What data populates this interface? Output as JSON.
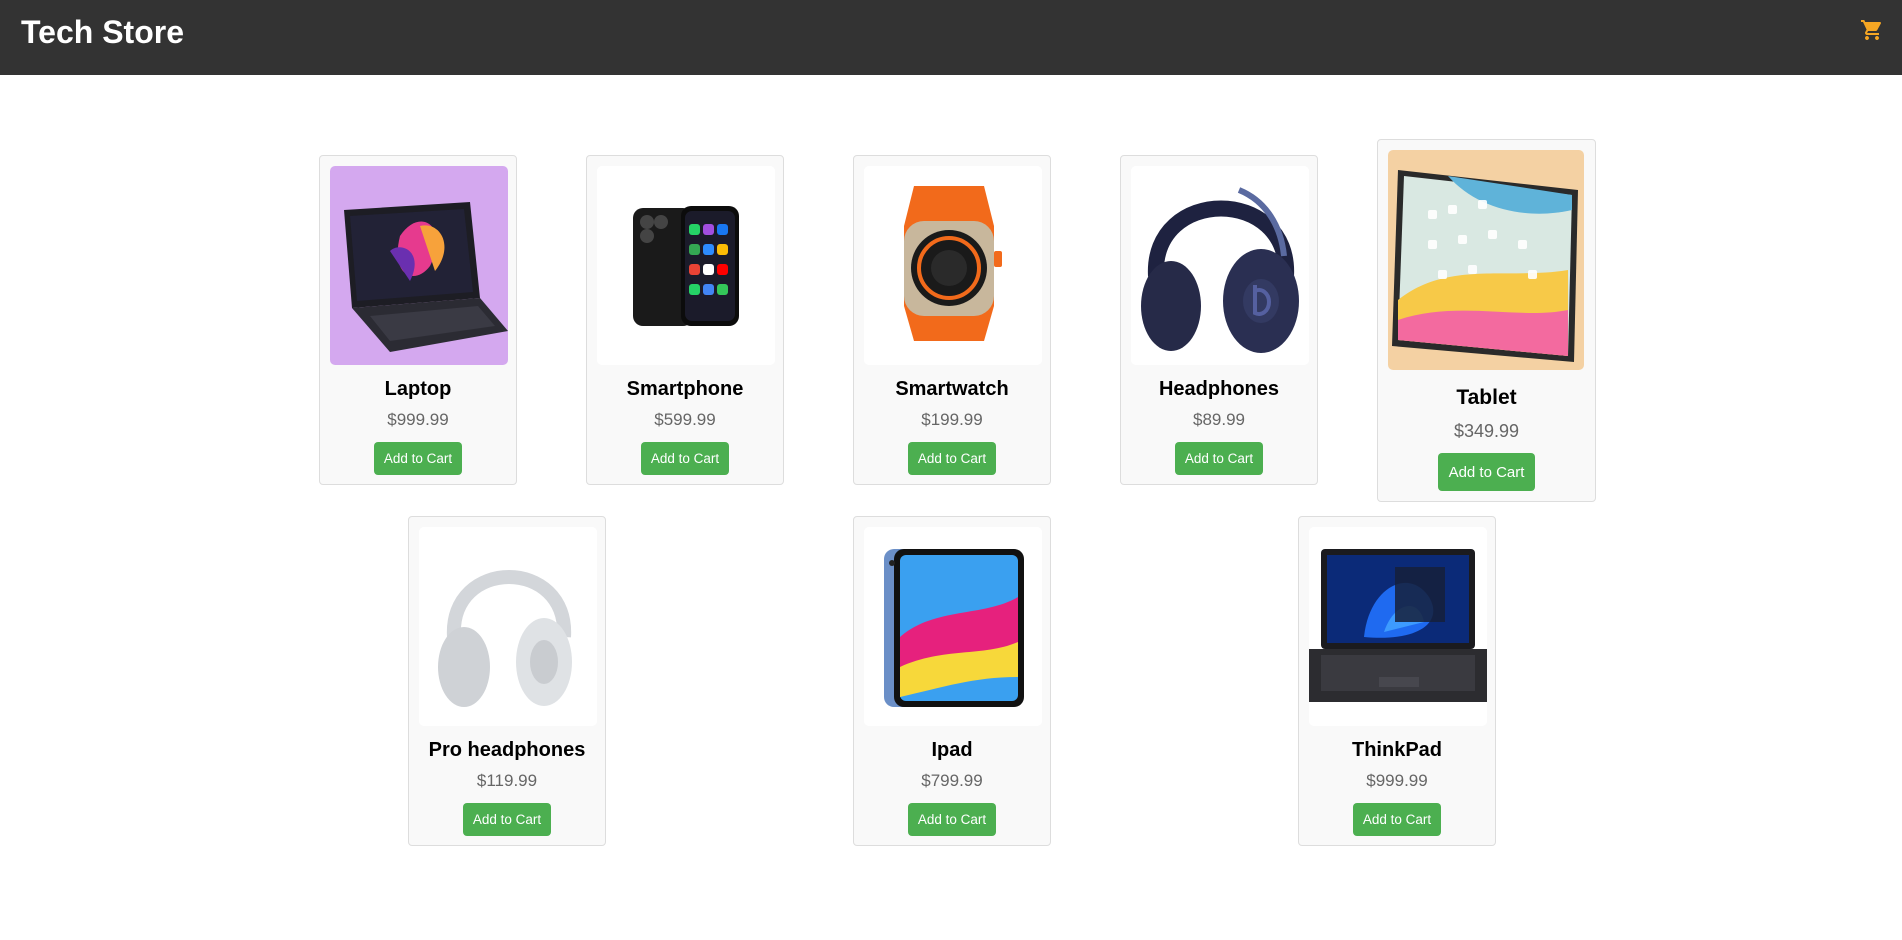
{
  "header": {
    "title": "Tech Store",
    "cart_icon": "shopping-cart-icon",
    "cart_color": "#f5a623",
    "background": "#333333"
  },
  "accent_color": "#4caf50",
  "products": [
    {
      "name": "Laptop",
      "price": "$999.99",
      "button": "Add to Cart",
      "image": "laptop-image"
    },
    {
      "name": "Smartphone",
      "price": "$599.99",
      "button": "Add to Cart",
      "image": "smartphone-image"
    },
    {
      "name": "Smartwatch",
      "price": "$199.99",
      "button": "Add to Cart",
      "image": "smartwatch-image"
    },
    {
      "name": "Headphones",
      "price": "$89.99",
      "button": "Add to Cart",
      "image": "headphones-image"
    },
    {
      "name": "Tablet",
      "price": "$349.99",
      "button": "Add to Cart",
      "image": "tablet-image"
    },
    {
      "name": "Pro headphones",
      "price": "$119.99",
      "button": "Add to Cart",
      "image": "pro-headphones-image"
    },
    {
      "name": "Ipad",
      "price": "$799.99",
      "button": "Add to Cart",
      "image": "ipad-image"
    },
    {
      "name": "ThinkPad",
      "price": "$999.99",
      "button": "Add to Cart",
      "image": "thinkpad-image"
    }
  ]
}
